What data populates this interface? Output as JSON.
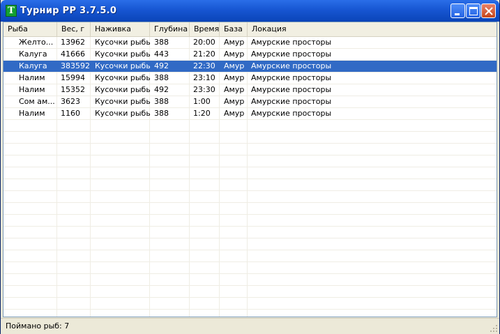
{
  "window": {
    "title": "Турнир РР 3.7.5.0",
    "icon_letter": "T",
    "icon_color": "#13a032",
    "titlebar_color": "#1756d2"
  },
  "table": {
    "columns": [
      "Рыба",
      "Вес, г",
      "Наживка",
      "Глубина",
      "Время",
      "База",
      "Локация"
    ],
    "rows": [
      [
        "Желто...",
        "13962",
        "Кусочки рыбы",
        "388",
        "20:00",
        "Амур",
        "Амурские просторы"
      ],
      [
        "Калуга",
        "41666",
        "Кусочки рыбы",
        "443",
        "21:20",
        "Амур",
        "Амурские просторы"
      ],
      [
        "Калуга",
        "383592",
        "Кусочки рыбы",
        "492",
        "22:30",
        "Амур",
        "Амурские просторы"
      ],
      [
        "Налим",
        "15994",
        "Кусочки рыбы",
        "388",
        "23:10",
        "Амур",
        "Амурские просторы"
      ],
      [
        "Налим",
        "15352",
        "Кусочки рыбы",
        "492",
        "23:30",
        "Амур",
        "Амурские просторы"
      ],
      [
        "Сом ам...",
        "3623",
        "Кусочки рыбы",
        "388",
        "1:00",
        "Амур",
        "Амурские просторы"
      ],
      [
        "Налим",
        "1160",
        "Кусочки рыбы",
        "388",
        "1:20",
        "Амур",
        "Амурские просторы"
      ]
    ],
    "selected_row": 2,
    "selection_color": "#316ac5"
  },
  "status": {
    "text": "Поймано рыб: 7"
  }
}
